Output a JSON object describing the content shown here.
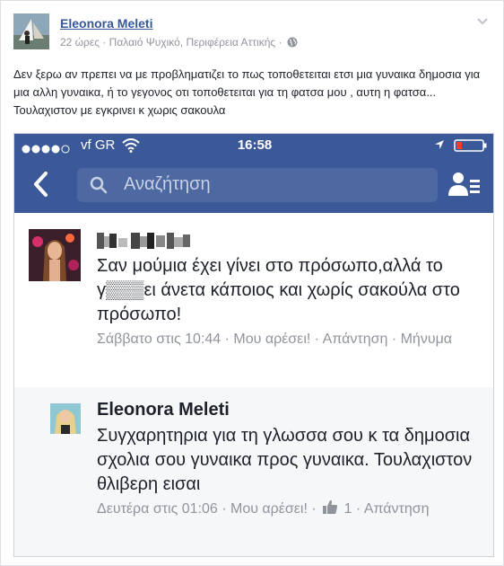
{
  "post": {
    "author": "Eleonora Meleti",
    "meta_text": "22 ώρες · Παλαιό Ψυχικό, Περιφέρεια Αττικής ·",
    "body": "Δεν ξερω αν πρεπει να με προβληματιζει το πως τοποθετειται ετσι μια γυναικα δημοσια για μια αλλη γυναικα, ή το γεγονος οτι τοποθετειται για τη φατσα μου , αυτη η φατσα... Τουλαχιστον με εγκρινει κ χωρις σακουλα"
  },
  "phone": {
    "statusbar": {
      "signal_dots": "●●●●○",
      "carrier": "vf GR",
      "time": "16:58"
    },
    "search": {
      "placeholder": "Αναζήτηση"
    },
    "comments": [
      {
        "author": "",
        "text": "Σαν μούμια έχει γίνει στο πρόσωπο,αλλά το γ▒▒▒ει άνετα κάποιος και χωρίς σακούλα στο πρόσωπο!",
        "meta": "Σάββατο στις 10:44 · Μου αρέσει! · Απάντηση · Μήνυμα"
      },
      {
        "author": "Eleonora Meleti",
        "text": "Συγχαρητηρια για τη γλωσσα σου κ τα δημοσια σχολια σου γυναικα προς γυναικα. Τουλαχιστον θλιβερη εισαι",
        "meta_prefix": "Δευτέρα στις 01:06 · Μου αρέσει! ·",
        "meta_suffix": "1 · Απάντηση"
      }
    ]
  },
  "colors": {
    "facebook_blue": "#3b5998",
    "link_blue": "#365899",
    "meta_grey": "#90949c"
  },
  "icons": [
    "globe-icon",
    "chevron-down-icon",
    "wifi-icon",
    "location-icon",
    "battery-icon",
    "back-icon",
    "search-icon",
    "friends-icon",
    "like-icon"
  ]
}
